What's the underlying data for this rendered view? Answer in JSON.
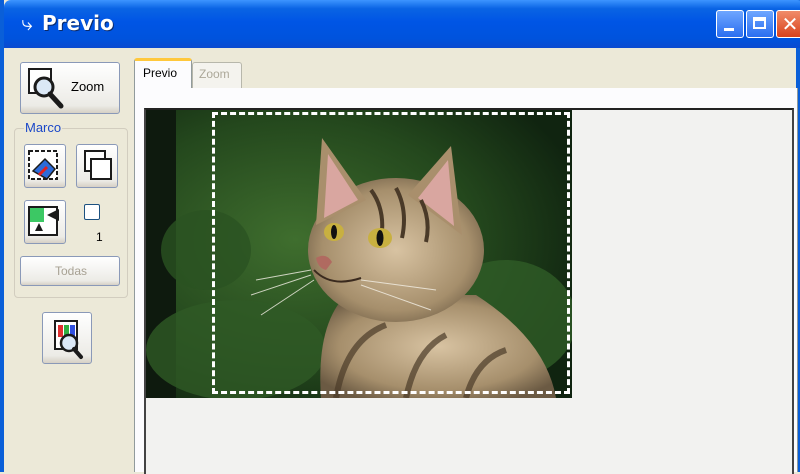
{
  "window": {
    "title": "Previo",
    "icon": "scanner-icon"
  },
  "left_panel": {
    "zoom_button_label": "Zoom",
    "marco_label": "Marco",
    "frame_count": "1",
    "todas_label": "Todas"
  },
  "tabs": [
    {
      "label": "Previo",
      "active": true
    },
    {
      "label": "Zoom",
      "active": false
    }
  ]
}
